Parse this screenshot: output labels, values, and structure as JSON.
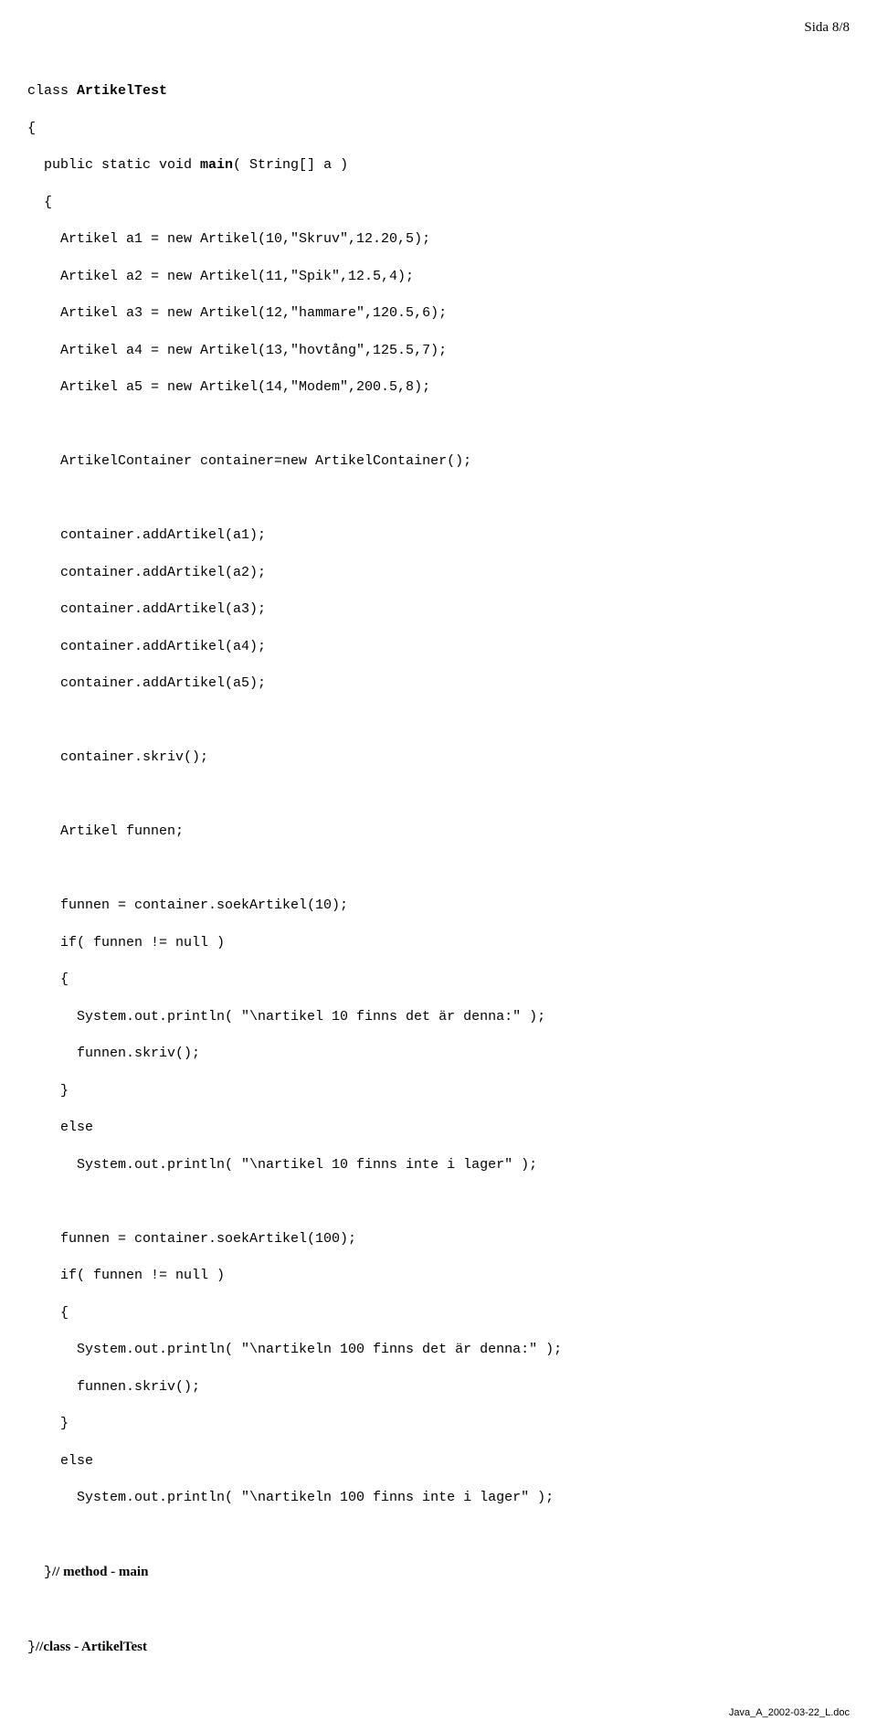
{
  "page_number": "Sida 8/8",
  "footer": "Java_A_2002-03-22_L.doc",
  "code": {
    "l01a": "class ",
    "l01b": "ArtikelTest",
    "l02": "{",
    "l03a": "public static void ",
    "l03b": "main",
    "l03c": "( String[] a )",
    "l04": "{",
    "l05": "Artikel a1 = new Artikel(10,\"Skruv\",12.20,5);",
    "l06": "Artikel a2 = new Artikel(11,\"Spik\",12.5,4);",
    "l07": "Artikel a3 = new Artikel(12,\"hammare\",120.5,6);",
    "l08": "Artikel a4 = new Artikel(13,\"hovtång\",125.5,7);",
    "l09": "Artikel a5 = new Artikel(14,\"Modem\",200.5,8);",
    "l10": "ArtikelContainer container=new ArtikelContainer();",
    "l11": "container.addArtikel(a1);",
    "l12": "container.addArtikel(a2);",
    "l13": "container.addArtikel(a3);",
    "l14": "container.addArtikel(a4);",
    "l15": "container.addArtikel(a5);",
    "l16": "container.skriv();",
    "l17": "Artikel funnen;",
    "l18": "funnen = container.soekArtikel(10);",
    "l19": "if( funnen != null )",
    "l20": "{",
    "l21": "System.out.println( \"\\nartikel 10 finns det är denna:\" );",
    "l22": "funnen.skriv();",
    "l23": "}",
    "l24": "else",
    "l25": "System.out.println( \"\\nartikel 10 finns inte i lager\" );",
    "l26": "funnen = container.soekArtikel(100);",
    "l27": "if( funnen != null )",
    "l28": "{",
    "l29": "System.out.println( \"\\nartikeln 100 finns det är denna:\" );",
    "l30": "funnen.skriv();",
    "l31": "}",
    "l32": "else",
    "l33": "System.out.println( \"\\nartikeln 100 finns inte i lager\" );",
    "l34a": "}",
    "l34b": "// method - main",
    "l35a": "}",
    "l35b": "//class - ArtikelTest"
  }
}
